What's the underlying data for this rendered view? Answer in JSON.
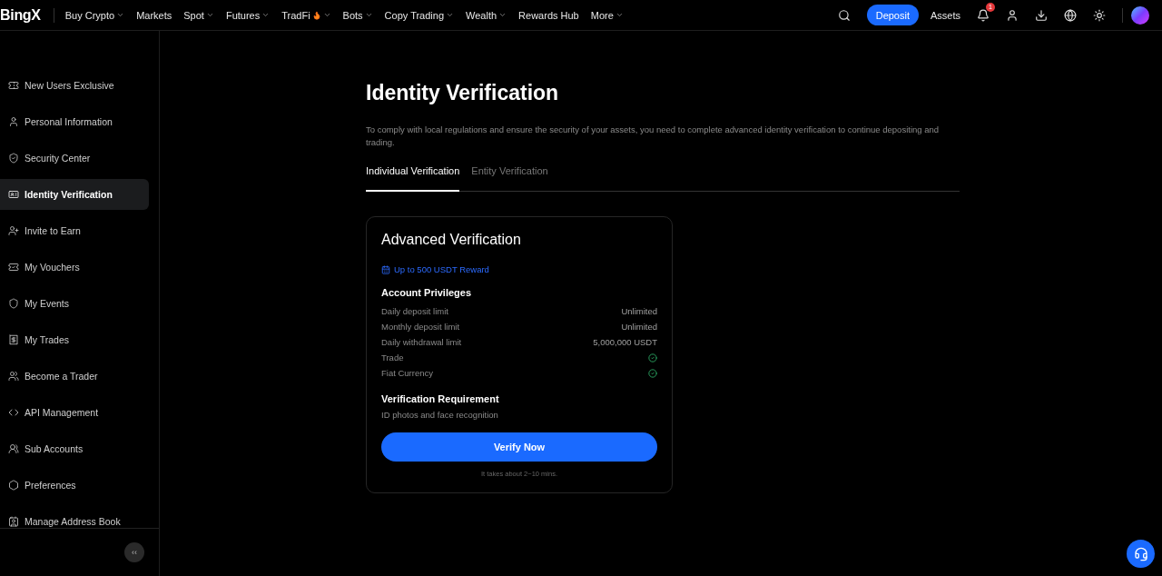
{
  "logo": "BingX",
  "nav": [
    {
      "label": "Buy Crypto",
      "dropdown": true,
      "hot": false
    },
    {
      "label": "Markets",
      "dropdown": false,
      "hot": false
    },
    {
      "label": "Spot",
      "dropdown": true,
      "hot": false
    },
    {
      "label": "Futures",
      "dropdown": true,
      "hot": false
    },
    {
      "label": "TradFi",
      "dropdown": true,
      "hot": true
    },
    {
      "label": "Bots",
      "dropdown": true,
      "hot": false
    },
    {
      "label": "Copy Trading",
      "dropdown": true,
      "hot": false
    },
    {
      "label": "Wealth",
      "dropdown": true,
      "hot": false
    },
    {
      "label": "Rewards Hub",
      "dropdown": false,
      "hot": false
    },
    {
      "label": "More",
      "dropdown": true,
      "hot": false
    }
  ],
  "header_actions": {
    "deposit": "Deposit",
    "assets": "Assets",
    "notification_count": "1"
  },
  "sidebar": {
    "items": [
      {
        "label": "New Users Exclusive",
        "selected": false
      },
      {
        "label": "Personal Information",
        "selected": false
      },
      {
        "label": "Security Center",
        "selected": false
      },
      {
        "label": "Identity Verification",
        "selected": true
      },
      {
        "label": "Invite to Earn",
        "selected": false
      },
      {
        "label": "My Vouchers",
        "selected": false
      },
      {
        "label": "My Events",
        "selected": false
      },
      {
        "label": "My Trades",
        "selected": false
      },
      {
        "label": "Become a Trader",
        "selected": false
      },
      {
        "label": "API Management",
        "selected": false
      },
      {
        "label": "Sub Accounts",
        "selected": false
      },
      {
        "label": "Preferences",
        "selected": false
      },
      {
        "label": "Manage Address Book",
        "selected": false
      }
    ],
    "collapse": "‹‹"
  },
  "title": "Identity Verification",
  "description": "To comply with local regulations and ensure the security of your assets, you need to complete advanced identity verification to continue depositing and trading.",
  "tabs": [
    {
      "label": "Individual Verification",
      "selected": true
    },
    {
      "label": "Entity Verification",
      "selected": false
    }
  ],
  "card": {
    "title": "Advanced Verification",
    "reward": "Up to 500 USDT Reward",
    "privileges_title": "Account Privileges",
    "privileges": [
      {
        "label": "Daily deposit limit",
        "kind": "text",
        "value": "Unlimited"
      },
      {
        "label": "Monthly deposit limit",
        "kind": "text",
        "value": "Unlimited"
      },
      {
        "label": "Daily withdrawal limit",
        "kind": "text",
        "value": "5,000,000 USDT"
      },
      {
        "label": "Trade",
        "kind": "check"
      },
      {
        "label": "Fiat Currency",
        "kind": "check"
      }
    ],
    "requirement_title": "Verification Requirement",
    "requirement": "ID photos and face recognition",
    "button": "Verify Now",
    "note": "It takes about 2~10 mins."
  }
}
